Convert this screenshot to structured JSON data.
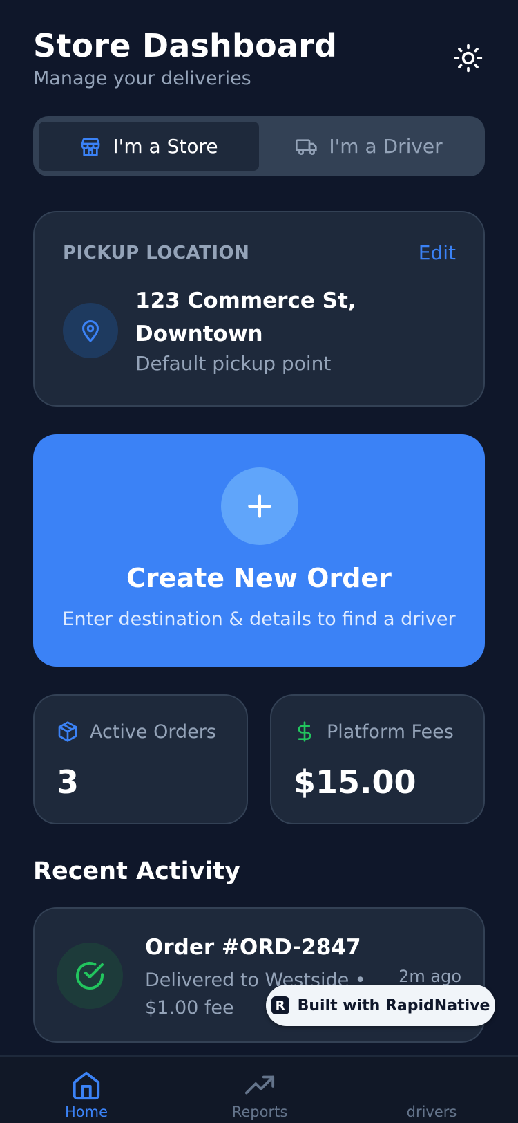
{
  "header": {
    "title": "Store Dashboard",
    "subtitle": "Manage your deliveries",
    "theme_icon": "sun-icon"
  },
  "role_toggle": {
    "store_label": "I'm a Store",
    "driver_label": "I'm a Driver",
    "selected": "store"
  },
  "pickup": {
    "label": "PICKUP LOCATION",
    "edit_label": "Edit",
    "address": "123 Commerce St, Downtown",
    "note": "Default pickup point"
  },
  "create_order": {
    "title": "Create New Order",
    "subtitle": "Enter destination & details to find a driver"
  },
  "stats": {
    "active_orders": {
      "label": "Active Orders",
      "value": "3"
    },
    "platform_fees": {
      "label": "Platform Fees",
      "value": "$15.00"
    }
  },
  "recent_activity": {
    "title": "Recent Activity",
    "items": [
      {
        "order": "Order #ORD-2847",
        "detail": "Delivered to Westside • $1.00 fee",
        "time": "2m ago",
        "status": "delivered"
      }
    ]
  },
  "badge": {
    "label": "Built with RapidNative",
    "logo": "R"
  },
  "nav": {
    "items": [
      {
        "label": "Home",
        "icon": "home-icon",
        "active": true
      },
      {
        "label": "Reports",
        "icon": "trending-up-icon",
        "active": false
      },
      {
        "label": "drivers",
        "icon": "users-icon",
        "active": false
      }
    ]
  },
  "colors": {
    "background": "#0f172a",
    "card": "#1e293b",
    "accent": "#3b82f6",
    "success": "#22c55e",
    "muted_text": "#94a3b8"
  }
}
